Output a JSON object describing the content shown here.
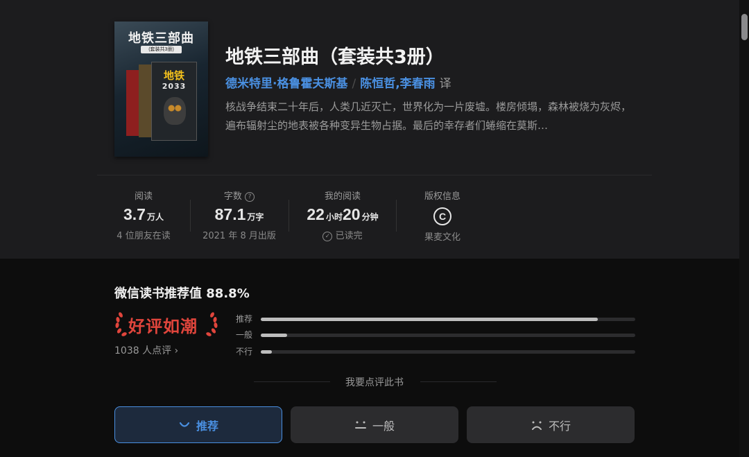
{
  "book": {
    "cover": {
      "title": "地铁三部曲",
      "subtitle": "(套装共3册)",
      "inner_title": "地铁",
      "inner_number": "2033"
    },
    "title": "地铁三部曲（套装共3册）",
    "author": "德米特里·格鲁霍夫斯基",
    "translators": "陈恒哲,李春雨",
    "translator_role": "译",
    "author_separator": "/",
    "description": "核战争结束二十年后，人类几近灭亡，世界化为一片废墟。楼房倾塌，森林被烧为灰烬，遍布辐射尘的地表被各种变异生物占据。最后的幸存者们蜷缩在莫斯…"
  },
  "stats": {
    "reading": {
      "label": "阅读",
      "value": "3.7",
      "unit": "万人",
      "sub": "4 位朋友在读"
    },
    "words": {
      "label": "字数",
      "info_icon": "question-circle-icon",
      "value": "87.1",
      "unit": "万字",
      "sub": "2021 年 8 月出版"
    },
    "my_reading": {
      "label": "我的阅读",
      "hours": "22",
      "hours_unit": "小时",
      "minutes": "20",
      "minutes_unit": "分钟",
      "sub": "已读完"
    },
    "copyright": {
      "label": "版权信息",
      "symbol": "C",
      "sub": "果麦文化"
    }
  },
  "rating": {
    "title": "微信读书推荐值",
    "value": "88.8%",
    "badge": "好评如潮",
    "review_count": "1038 人点评",
    "bars": [
      {
        "label": "推荐",
        "fraction": 0.9
      },
      {
        "label": "一般",
        "fraction": 0.07
      },
      {
        "label": "不行",
        "fraction": 0.03
      }
    ]
  },
  "comment_prompt": "我要点评此书",
  "votes": [
    {
      "label": "推荐",
      "icon": "smile-icon"
    },
    {
      "label": "一般",
      "icon": "neutral-face-icon"
    },
    {
      "label": "不行",
      "icon": "frown-icon"
    }
  ],
  "colors": {
    "accent": "#4a90e2",
    "badge": "#e0453c",
    "background": "#0d0d0d",
    "panel": "#1c1c1e"
  }
}
